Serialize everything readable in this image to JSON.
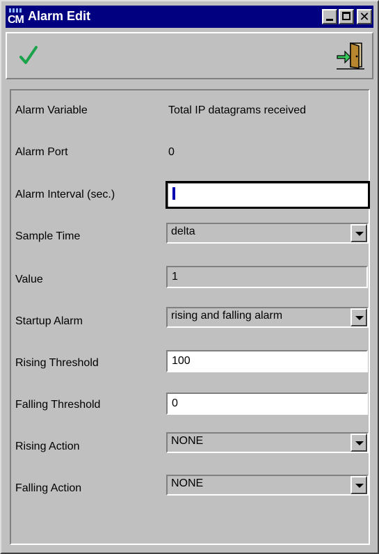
{
  "window": {
    "title": "Alarm Edit",
    "app_icon_text": "CM"
  },
  "titlebar_buttons": {
    "minimize": "minimize",
    "maximize": "maximize",
    "close": "✕"
  },
  "toolbar": {
    "ok_icon": "checkmark-icon",
    "exit_icon": "exit-door-icon",
    "ok_color": "#1aa34a"
  },
  "form": {
    "alarm_variable": {
      "label": "Alarm Variable",
      "value": "Total IP datagrams received"
    },
    "alarm_port": {
      "label": "Alarm Port",
      "value": "0"
    },
    "alarm_interval": {
      "label": "Alarm Interval (sec.)",
      "value": ""
    },
    "sample_time": {
      "label": "Sample Time",
      "value": "delta"
    },
    "value": {
      "label": "Value",
      "value": "1"
    },
    "startup_alarm": {
      "label": "Startup Alarm",
      "value": "rising and falling alarm"
    },
    "rising_threshold": {
      "label": "Rising Threshold",
      "value": "100"
    },
    "falling_threshold": {
      "label": "Falling Threshold",
      "value": "0"
    },
    "rising_action": {
      "label": "Rising Action",
      "value": "NONE"
    },
    "falling_action": {
      "label": "Falling Action",
      "value": "NONE"
    }
  }
}
